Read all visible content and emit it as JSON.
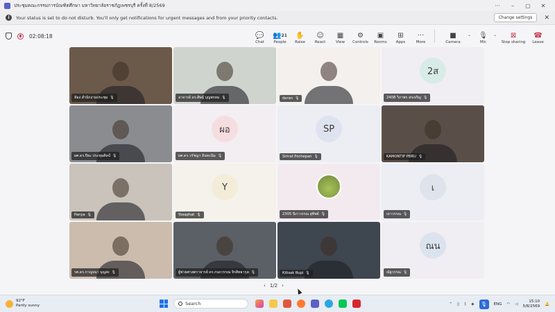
{
  "window": {
    "title": "ประชุมคณะกรรมการบัณฑิตศึกษา มหาวิทยาลัยราชภัฏเพชรบุรี ครั้งที่ 8/2569"
  },
  "notification": {
    "message": "Your status is set to do not disturb. You'll only get notifications for urgent messages and from your priority contacts.",
    "change_label": "Change settings"
  },
  "meeting": {
    "timer": "02:08:18",
    "people_count": "21"
  },
  "toolbar": [
    {
      "id": "chat",
      "label": "Chat",
      "icon": "chat-icon",
      "glyph": "💬"
    },
    {
      "id": "people",
      "label": "People",
      "icon": "people-icon",
      "glyph": "👥"
    },
    {
      "id": "raise",
      "label": "Raise",
      "icon": "hand-icon",
      "glyph": "✋"
    },
    {
      "id": "react",
      "label": "React",
      "icon": "smile-icon",
      "glyph": "☺"
    },
    {
      "id": "view",
      "label": "View",
      "icon": "grid-icon",
      "glyph": "▦"
    },
    {
      "id": "controls",
      "label": "Controls",
      "icon": "controls-icon",
      "glyph": "⚙"
    },
    {
      "id": "rooms",
      "label": "Rooms",
      "icon": "rooms-icon",
      "glyph": "▣"
    },
    {
      "id": "apps",
      "label": "Apps",
      "icon": "plus-icon",
      "glyph": "⊞"
    },
    {
      "id": "more",
      "label": "More",
      "icon": "more-icon",
      "glyph": "···"
    }
  ],
  "media": {
    "camera_label": "Camera",
    "mic_label": "Mic",
    "stop_sharing_label": "Stop sharing",
    "leave_label": "Leave"
  },
  "participants": [
    {
      "name": "ห้อง สำนักงานประชุม",
      "type": "video",
      "bg": "#6b5a4a"
    },
    {
      "name": "อาจารย์ ดร.ศิษฐ์ บุญพรหม",
      "type": "video",
      "bg": "#cfd4cf"
    },
    {
      "name": "daran",
      "type": "video",
      "bg": "#f3f0ee"
    },
    {
      "name": "2408 วิภาพร สรเจริญ",
      "type": "avatar",
      "initials": "2ส",
      "bg": "#f1eef3",
      "avatar_bg": "#d8ece7"
    },
    {
      "name": "ผศ.ดร.ปิยะ ประทุมศิลป์",
      "type": "video",
      "bg": "#8a8c90"
    },
    {
      "name": "ผศ.ดร.วรัชญา อินทะนิม",
      "type": "avatar",
      "initials": "ผอ",
      "bg": "#f3eef1",
      "avatar_bg": "#f6dde0"
    },
    {
      "name": "Sirirat Pochepan",
      "type": "avatar",
      "initials": "SP",
      "bg": "#eceef3",
      "avatar_bg": "#dfe2ef"
    },
    {
      "name": "KAMONTIP PBRU",
      "type": "video",
      "bg": "#5a4f48"
    },
    {
      "name": "Panya",
      "type": "video",
      "bg": "#c9c3bb"
    },
    {
      "name": "Yosaphat",
      "type": "avatar",
      "initials": "Y",
      "bg": "#f4f2ea",
      "avatar_bg": "#f3ecd9"
    },
    {
      "name": "2305 นิภาวรรณ สุทิพย์",
      "type": "image",
      "bg": "#f3eaf0"
    },
    {
      "name": "เยาวรรณ",
      "type": "avatar",
      "initials": "เ",
      "bg": "#eceef3",
      "avatar_bg": "#dfe4ec"
    },
    {
      "name": "รศ.ดร.กาญจนา บุญส่ง",
      "type": "video",
      "bg": "#cbbcae"
    },
    {
      "name": "ผู้ช่วยศาสตราจารย์ ดร.กนกวรรณ จิรสิทธากุล",
      "type": "video",
      "bg": "#5b5f66"
    },
    {
      "name": "Kitisak Rupi",
      "type": "video",
      "bg": "#3e4650"
    },
    {
      "name": "ณัฐวรรณ",
      "type": "avatar",
      "initials": "ณน",
      "bg": "#f1eef3",
      "avatar_bg": "#dbe3ee"
    }
  ],
  "pager": {
    "label": "1/2"
  },
  "taskbar": {
    "weather_temp": "92°F",
    "weather_desc": "Partly sunny",
    "search_placeholder": "Search",
    "lang": "ENG",
    "time": "15:10",
    "date": "5/8/2569"
  }
}
